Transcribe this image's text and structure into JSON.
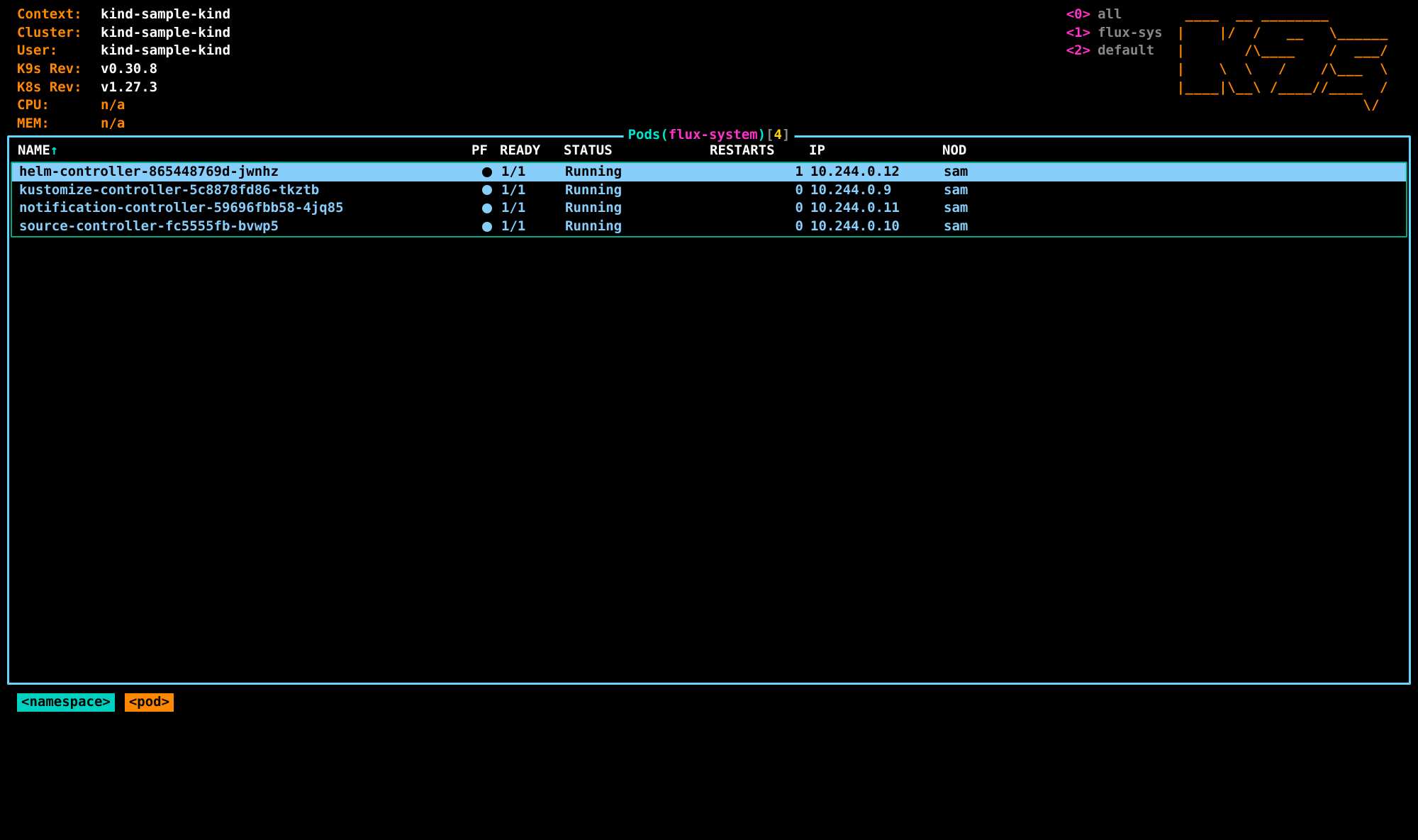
{
  "info": {
    "context_label": "Context:",
    "context_value": "kind-sample-kind",
    "cluster_label": "Cluster:",
    "cluster_value": "kind-sample-kind",
    "user_label": "User:",
    "user_value": "kind-sample-kind",
    "k9s_label": "K9s Rev:",
    "k9s_value": "v0.30.8",
    "k8s_label": "K8s Rev:",
    "k8s_value": "v1.27.3",
    "cpu_label": "CPU:",
    "cpu_value": "n/a",
    "mem_label": "MEM:",
    "mem_value": "n/a"
  },
  "namespaces": [
    {
      "key": "<0>",
      "label": "all"
    },
    {
      "key": "<1>",
      "label": "flux-sys"
    },
    {
      "key": "<2>",
      "label": "default"
    }
  ],
  "logo": " ____  __ ________        \n|    |/  /   __   \\______ \n|       /\\____    /  ___/ \n|    \\  \\   /    /\\___  \\ \n|____|\\__\\ /____//____  / \n                      \\/  ",
  "pane": {
    "title_main": "Pods",
    "title_ns": "flux-system",
    "count": "4",
    "sort_col": "NAME",
    "sort_arrow": "↑",
    "headers": {
      "name": "NAME",
      "pf": "PF",
      "ready": "READY",
      "status": "STATUS",
      "restarts": "RESTARTS",
      "ip": "IP",
      "node": "NOD"
    }
  },
  "rows": [
    {
      "name": "helm-controller-865448769d-jwnhz",
      "pf": "●",
      "ready": "1/1",
      "status": "Running",
      "restarts": "1",
      "ip": "10.244.0.12",
      "node": "sam",
      "selected": true
    },
    {
      "name": "kustomize-controller-5c8878fd86-tkztb",
      "pf": "●",
      "ready": "1/1",
      "status": "Running",
      "restarts": "0",
      "ip": "10.244.0.9",
      "node": "sam",
      "selected": false
    },
    {
      "name": "notification-controller-59696fbb58-4jq85",
      "pf": "●",
      "ready": "1/1",
      "status": "Running",
      "restarts": "0",
      "ip": "10.244.0.11",
      "node": "sam",
      "selected": false
    },
    {
      "name": "source-controller-fc5555fb-bvwp5",
      "pf": "●",
      "ready": "1/1",
      "status": "Running",
      "restarts": "0",
      "ip": "10.244.0.10",
      "node": "sam",
      "selected": false
    }
  ],
  "footer": {
    "namespace": "<namespace>",
    "pod": "<pod>"
  }
}
